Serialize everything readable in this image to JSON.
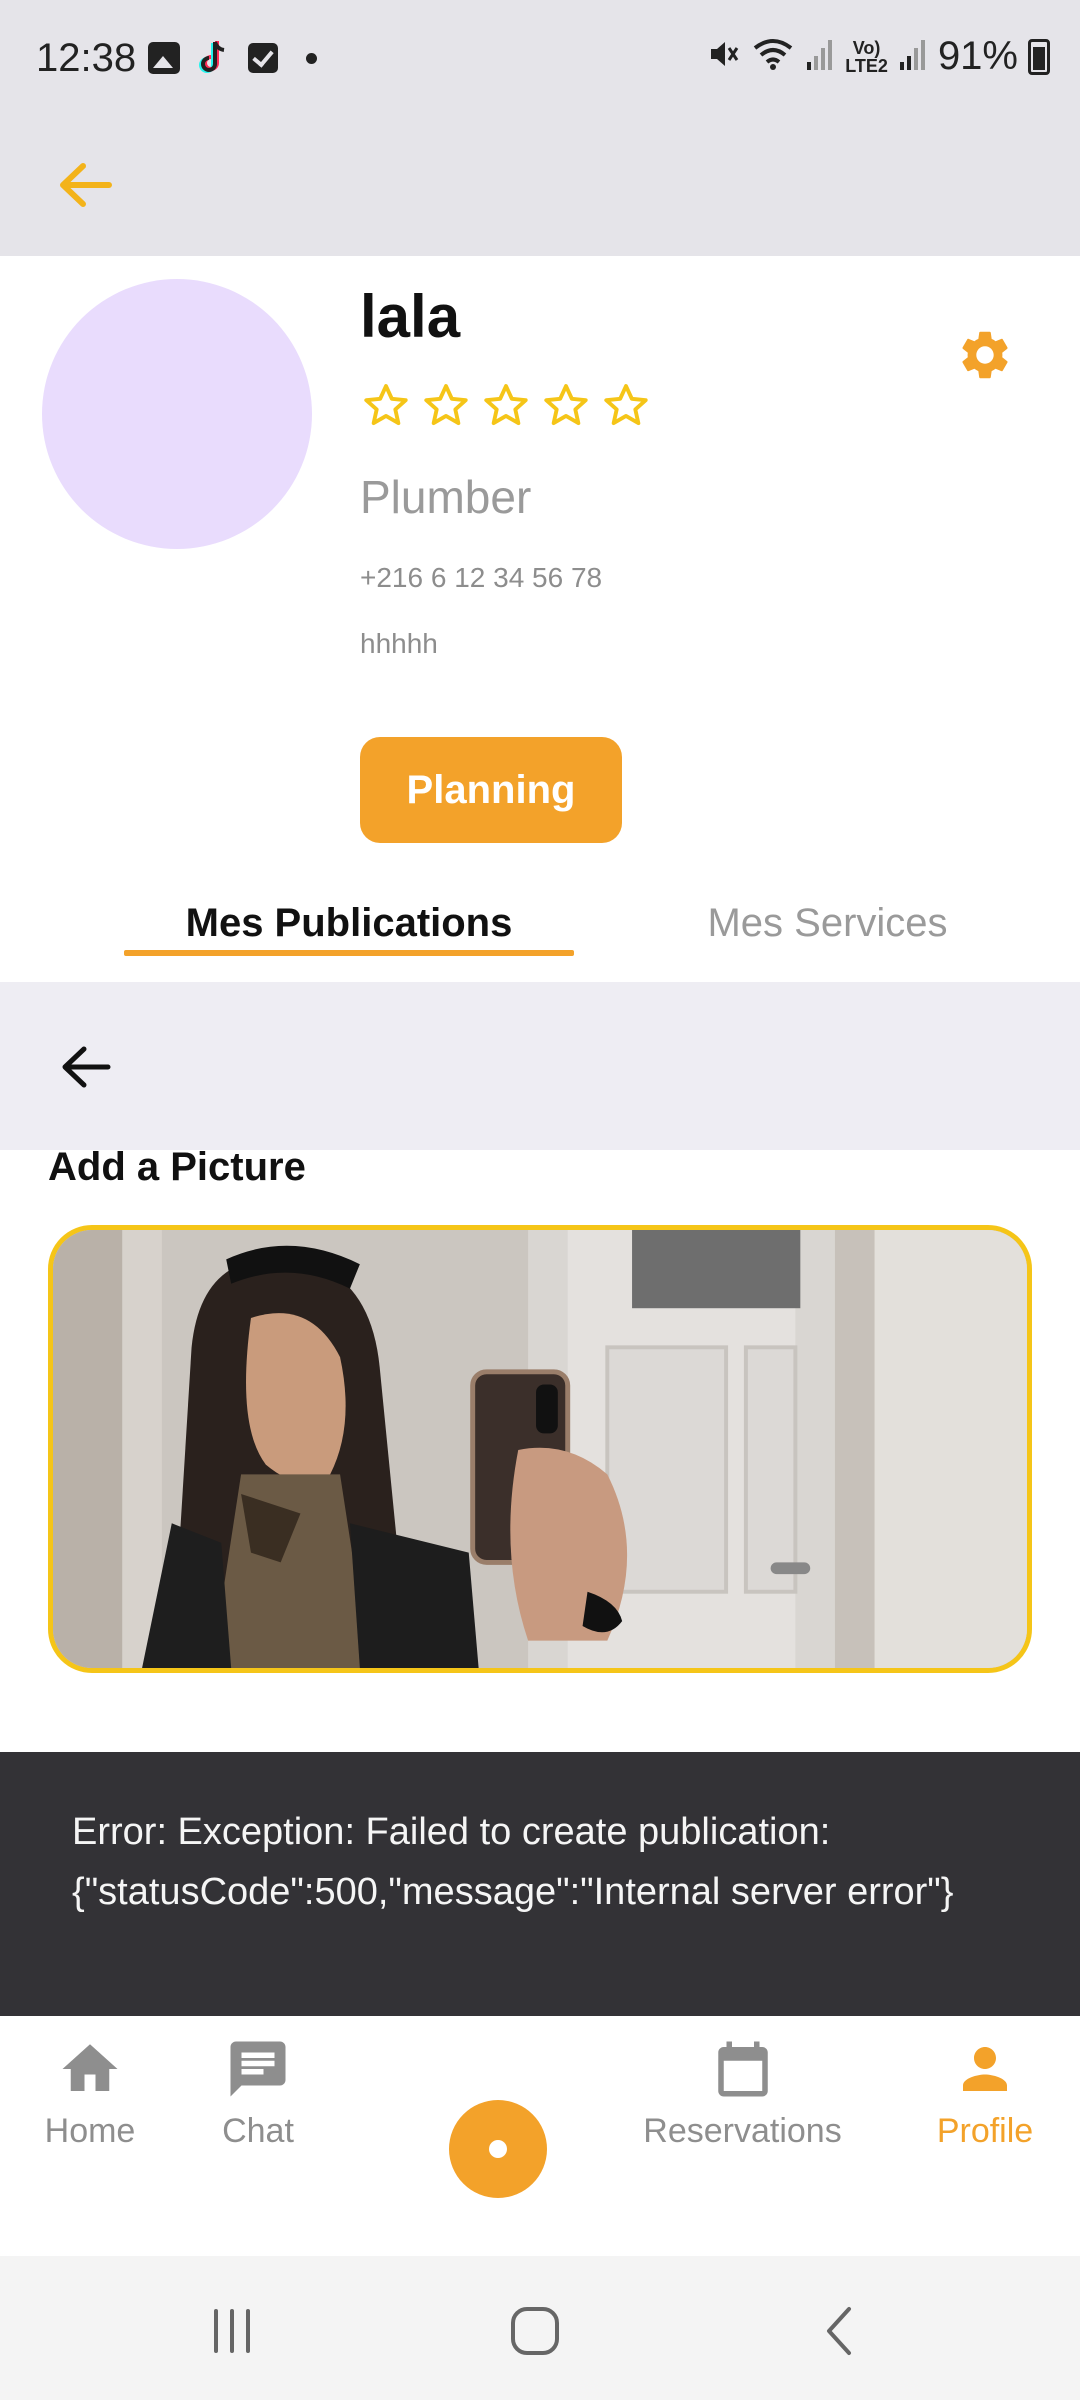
{
  "status_bar": {
    "time": "12:38",
    "battery": "91%",
    "lte_label_top": "Vo)",
    "lte_label_bottom": "LTE2",
    "icons": [
      "gallery-icon",
      "tiktok-icon",
      "check-icon",
      "dot-icon",
      "mute-icon",
      "wifi-icon",
      "signal-icon",
      "battery-icon"
    ]
  },
  "app_bar": {
    "back_icon": "arrow-back-icon"
  },
  "profile": {
    "name": "lala",
    "rating": 0,
    "rating_max": 5,
    "profession": "Plumber",
    "phone": "+216 6 12 34 56 78",
    "description": "hhhhh",
    "avatar_color": "#e9dcfd"
  },
  "actions": {
    "planning_label": "Planning"
  },
  "tabs": [
    {
      "label": "Mes Publications",
      "active": true
    },
    {
      "label": "Mes Services",
      "active": false
    }
  ],
  "form": {
    "add_picture_label": "Add a Picture"
  },
  "snackbar": {
    "message": "Error: Exception: Failed to create publication: {\"statusCode\":500,\"message\":\"Internal server error\"}"
  },
  "bottom_nav": {
    "items": [
      {
        "label": "Home",
        "icon": "home-icon"
      },
      {
        "label": "Chat",
        "icon": "chat-icon"
      },
      {
        "label": "Reservations",
        "icon": "calendar-icon"
      },
      {
        "label": "Profile",
        "icon": "person-icon",
        "active": true
      }
    ]
  },
  "colors": {
    "accent": "#f3a22a",
    "star": "#f5c518",
    "inactive": "#8e8e8e",
    "header_bg": "#e5e4e9"
  }
}
